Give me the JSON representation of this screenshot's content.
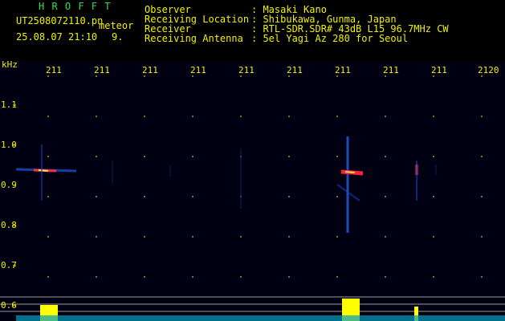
{
  "header": {
    "brand": "H R O F F T",
    "filename": "UT2508072110.pn",
    "mode": "meteor",
    "datetime": "25.08.07 21:10",
    "count": "9.",
    "info": [
      {
        "label": "Observer",
        "value": ": Masaki Kano"
      },
      {
        "label": "Receiving Location",
        "value": ": Shibukawa, Gunma, Japan"
      },
      {
        "label": "Receiver",
        "value": ": RTL-SDR.SDR# 43dB L15 96.7MHz CW"
      },
      {
        "label": "Receiving Antenna",
        "value": ": 5el Yagi Az 280 for Seoul"
      }
    ]
  },
  "axis": {
    "unit": "kHz",
    "x_ticks": [
      "211",
      "211",
      "211",
      "211",
      "211",
      "211",
      "211",
      "211",
      "211",
      "2120"
    ],
    "y_ticks": [
      "1.1",
      "1.0",
      "0.9",
      "0.8",
      "0.7",
      "0.6"
    ]
  },
  "colors": {
    "background": "#000010",
    "label": "#f0f000",
    "brand": "#2fe04a",
    "histogram": "#ffff00",
    "trace": "#00d0ff"
  }
}
